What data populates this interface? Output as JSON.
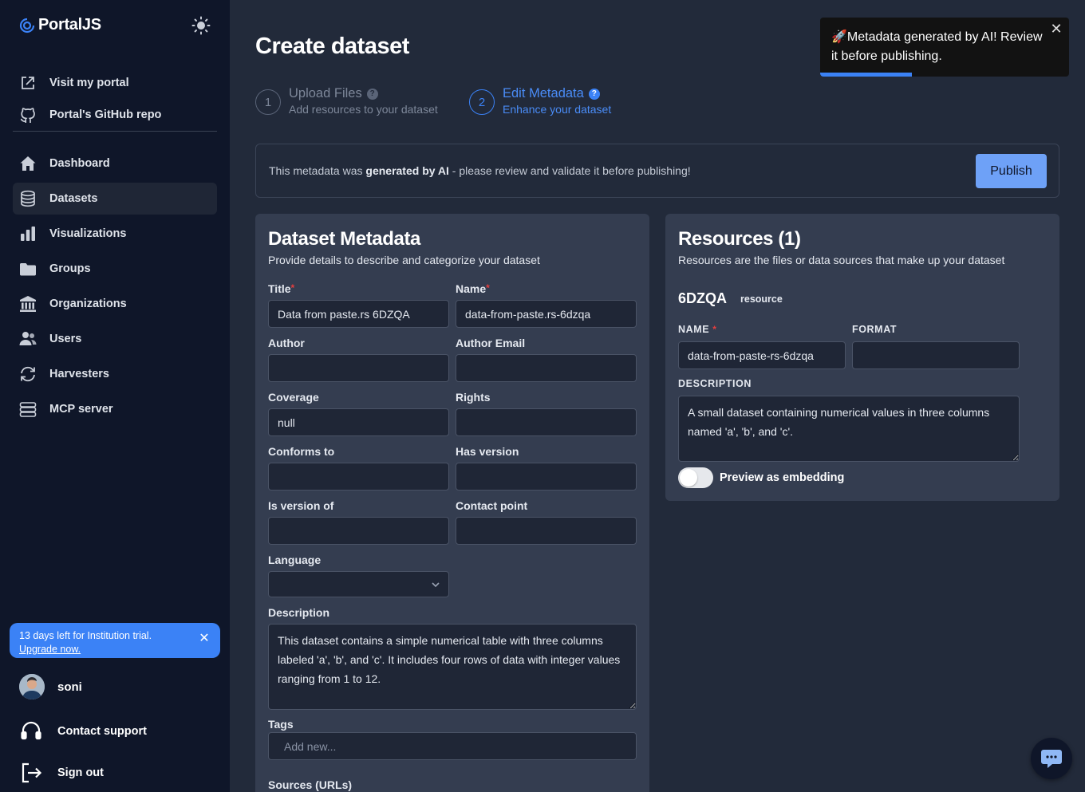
{
  "app": {
    "name": "PortalJS"
  },
  "sidebar": {
    "links": [
      {
        "label": "Visit my portal",
        "icon": "external-link-icon"
      },
      {
        "label": "Portal's GitHub repo",
        "icon": "github-icon"
      }
    ],
    "items": [
      {
        "label": "Dashboard",
        "icon": "home-icon",
        "active": false
      },
      {
        "label": "Datasets",
        "icon": "database-icon",
        "active": true
      },
      {
        "label": "Visualizations",
        "icon": "bar-chart-icon",
        "active": false
      },
      {
        "label": "Groups",
        "icon": "folder-icon",
        "active": false
      },
      {
        "label": "Organizations",
        "icon": "building-icon",
        "active": false
      },
      {
        "label": "Users",
        "icon": "users-icon",
        "active": false
      },
      {
        "label": "Harvesters",
        "icon": "refresh-icon",
        "active": false
      },
      {
        "label": "MCP server",
        "icon": "server-icon",
        "active": false
      }
    ],
    "trial": {
      "text": "13 days left for Institution trial.",
      "link": "Upgrade now."
    },
    "user": {
      "name": "soni"
    },
    "contact_support": "Contact support",
    "sign_out": "Sign out"
  },
  "page": {
    "title": "Create dataset",
    "steps": [
      {
        "number": "1",
        "title": "Upload Files",
        "subtitle": "Add resources to your dataset",
        "active": false
      },
      {
        "number": "2",
        "title": "Edit Metadata",
        "subtitle": "Enhance your dataset",
        "active": true
      }
    ],
    "ai_banner": {
      "prefix": "This metadata was ",
      "bold": "generated by AI",
      "suffix": " - please review and validate it before publishing!"
    },
    "publish_label": "Publish"
  },
  "metadata": {
    "title": "Dataset Metadata",
    "subtitle": "Provide details to describe and categorize your dataset",
    "fields": {
      "title": {
        "label": "Title",
        "value": "Data from paste.rs 6DZQA"
      },
      "name": {
        "label": "Name",
        "value": "data-from-paste.rs-6dzqa"
      },
      "author": {
        "label": "Author",
        "value": ""
      },
      "author_email": {
        "label": "Author Email",
        "value": ""
      },
      "coverage": {
        "label": "Coverage",
        "value": "null"
      },
      "rights": {
        "label": "Rights",
        "value": ""
      },
      "conforms_to": {
        "label": "Conforms to",
        "value": ""
      },
      "has_version": {
        "label": "Has version",
        "value": ""
      },
      "is_version_of": {
        "label": "Is version of",
        "value": ""
      },
      "contact_point": {
        "label": "Contact point",
        "value": ""
      },
      "language": {
        "label": "Language",
        "value": ""
      },
      "description": {
        "label": "Description",
        "value": "This dataset contains a simple numerical table with three columns labeled 'a', 'b', and 'c'. It includes four rows of data with integer values ranging from 1 to 12."
      },
      "tags": {
        "label": "Tags",
        "placeholder": "Add new..."
      },
      "sources": {
        "label": "Sources (URLs)"
      }
    }
  },
  "resources": {
    "title": "Resources (1)",
    "subtitle": "Resources are the files or data sources that make up your dataset",
    "item": {
      "id": "6DZQA",
      "badge": "resource",
      "name_label": "NAME",
      "name_value": "data-from-paste-rs-6dzqa",
      "format_label": "FORMAT",
      "format_value": "",
      "description_label": "DESCRIPTION",
      "description_value": "A small dataset containing numerical values in three columns named 'a', 'b', and 'c'.",
      "preview_label": "Preview as embedding",
      "preview_enabled": false
    }
  },
  "toast": {
    "text": "🚀Metadata generated by AI! Review it before publishing.",
    "progress": 0.37
  },
  "colors": {
    "accent": "#3b82f6",
    "sidebar_bg": "#0f1629",
    "main_bg": "#222a3a",
    "panel_bg": "#343d50"
  }
}
